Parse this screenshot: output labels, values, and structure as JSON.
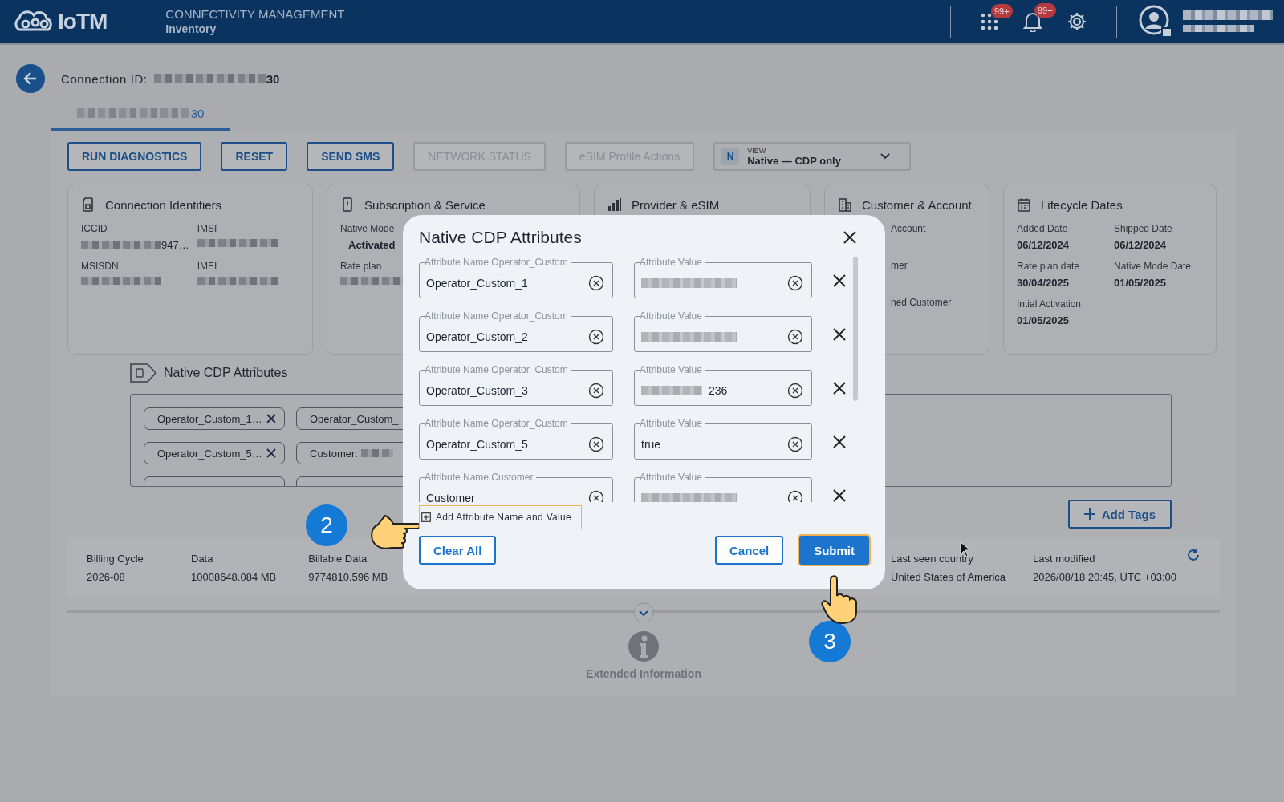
{
  "header": {
    "logo": "IoTM",
    "app_title": "CONNECTIVITY MANAGEMENT",
    "section": "Inventory",
    "notifications": [
      {
        "kind": "apps",
        "count": "99+"
      },
      {
        "kind": "bell",
        "count": "99+"
      }
    ]
  },
  "connection": {
    "label": "Connection ID:",
    "id_end": "30"
  },
  "tabs": [
    {
      "label_end": "30",
      "selected": true
    }
  ],
  "actions": [
    {
      "label": "RUN DIAGNOSTICS",
      "disabled": false
    },
    {
      "label": "RESET",
      "disabled": false
    },
    {
      "label": "SEND SMS",
      "disabled": false
    },
    {
      "label": "NETWORK STATUS",
      "disabled": true
    },
    {
      "label": "eSIM Profile Actions",
      "disabled": true
    }
  ],
  "view_select": {
    "badge": "N",
    "label": "VIEW",
    "value": "Native — CDP only"
  },
  "cards": [
    {
      "title": "Connection Identifiers",
      "fields": [
        {
          "label": "ICCID",
          "redacted": true,
          "value": "947…"
        },
        {
          "label": "IMSI",
          "redacted": true
        },
        {
          "label": "MSISDN",
          "redacted": true
        },
        {
          "label": "IMEI",
          "redacted": true
        }
      ]
    },
    {
      "title": "Subscription & Service",
      "fields": [
        {
          "label": "Native Mode",
          "redacted": false,
          "value": "Activated"
        },
        {
          "label": "Rate plan",
          "redacted": true
        }
      ]
    },
    {
      "title": "Provider & eSIM"
    },
    {
      "title": "Customer & Account",
      "fields": [
        {
          "label": "Account",
          "redacted": false
        },
        {
          "label": "mer",
          "redacted": false
        },
        {
          "label": "ned Customer",
          "redacted": false
        }
      ]
    },
    {
      "title": "Lifecycle Dates",
      "fields": [
        {
          "label": "Added Date",
          "redacted": false,
          "value": "06/12/2024"
        },
        {
          "label": "Shipped Date",
          "redacted": false,
          "value": "06/12/2024"
        },
        {
          "label": "Rate plan date",
          "redacted": false,
          "value": "30/04/2025"
        },
        {
          "label": "Native Mode Date",
          "redacted": false,
          "value": "01/05/2025"
        },
        {
          "label": "Intial Activation",
          "redacted": false,
          "value": "01/05/2025"
        }
      ]
    }
  ],
  "cdp_section": {
    "title": "Native CDP Attributes",
    "chips": [
      {
        "text": "Operator_Custom_1…",
        "redacted": false,
        "removable": true
      },
      {
        "text": "Operator_Custom_",
        "redacted": false
      },
      {
        "text": "Operator_Custom_5…",
        "redacted": false,
        "removable": true
      },
      {
        "text": "Customer:",
        "redacted": true
      }
    ],
    "add_tags": "Add Tags"
  },
  "stats": [
    {
      "label": "Billing Cycle",
      "value": "2026-08"
    },
    {
      "label": "Data",
      "value": "10008648.084 MB"
    },
    {
      "label": "Billable Data",
      "value": "9774810.596 MB"
    },
    {
      "label": "Last seen country",
      "value": "United States of America"
    },
    {
      "label": "Last modified",
      "value": "2026/08/18 20:45, UTC +03:00"
    }
  ],
  "extended": "Extended Information",
  "modal": {
    "title": "Native CDP Attributes",
    "rows": [
      {
        "name_label": "Attribute Name Operator_Custom",
        "name": "Operator_Custom_1",
        "value_label": "Attribute Value",
        "value_redacted": true
      },
      {
        "name_label": "Attribute Name Operator_Custom",
        "name": "Operator_Custom_2",
        "value_label": "Attribute Value",
        "value_redacted": true
      },
      {
        "name_label": "Attribute Name Operator_Custom",
        "name": "Operator_Custom_3",
        "value_label": "Attribute Value",
        "value_redacted": true,
        "value": "236"
      },
      {
        "name_label": "Attribute Name Operator_Custom",
        "name": "Operator_Custom_5",
        "value_label": "Attribute Value",
        "value_redacted": false,
        "value": "true"
      },
      {
        "name_label": "Attribute Name Customer",
        "name": "Customer",
        "value_label": "Attribute Value",
        "value_redacted": true
      }
    ],
    "add_button": {
      "label": "Add Attribute Name and Value",
      "highlighted": true
    },
    "buttons": [
      {
        "label": "Clear All",
        "kind": "outline",
        "highlighted": false
      },
      {
        "label": "Cancel",
        "kind": "outline",
        "highlighted": false
      },
      {
        "label": "Submit",
        "kind": "primary",
        "highlighted": true
      }
    ]
  },
  "steps": [
    {
      "number": "2"
    },
    {
      "number": "3"
    }
  ]
}
